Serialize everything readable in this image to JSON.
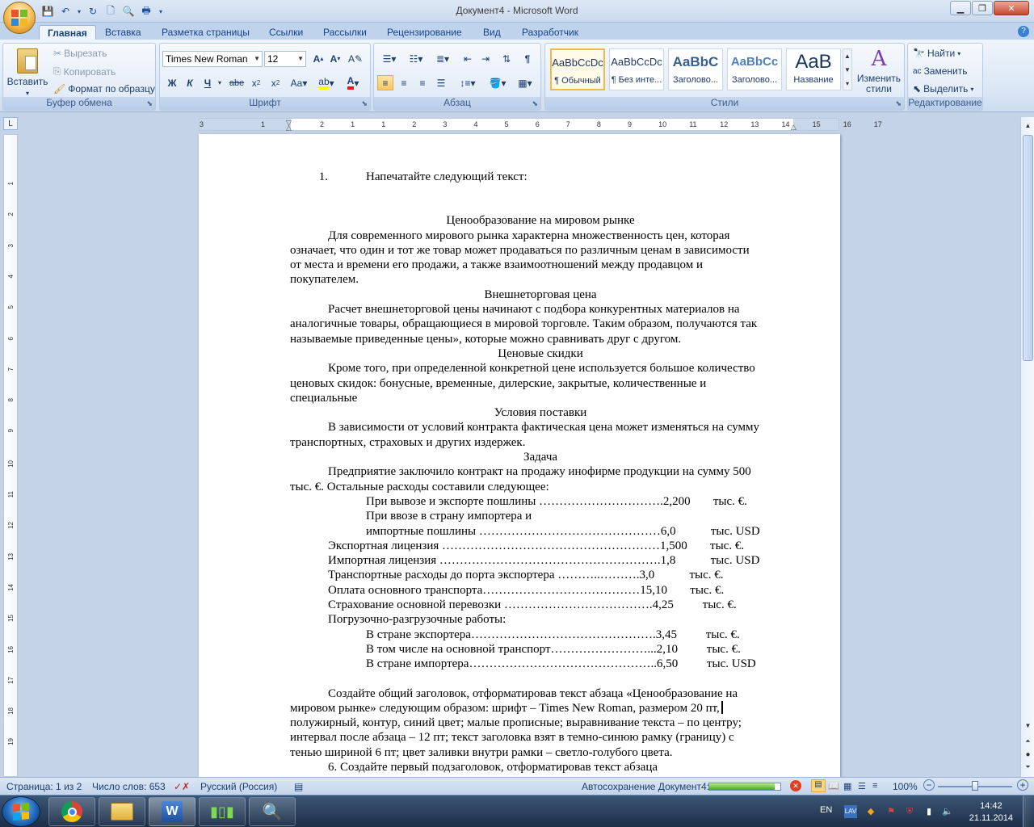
{
  "window": {
    "title": "Документ4 - Microsoft Word"
  },
  "tabs": [
    "Главная",
    "Вставка",
    "Разметка страницы",
    "Ссылки",
    "Рассылки",
    "Рецензирование",
    "Вид",
    "Разработчик"
  ],
  "clipboard": {
    "paste": "Вставить",
    "cut": "Вырезать",
    "copy": "Копировать",
    "format_painter": "Формат по образцу",
    "title": "Буфер обмена"
  },
  "font": {
    "name": "Times New Roman",
    "size": "12",
    "title": "Шрифт"
  },
  "paragraph": {
    "title": "Абзац"
  },
  "styles": {
    "items": [
      {
        "sample": "AaBbCcDc",
        "name": "¶ Обычный"
      },
      {
        "sample": "AaBbCcDc",
        "name": "¶ Без инте..."
      },
      {
        "sample": "AaBbC",
        "name": "Заголово..."
      },
      {
        "sample": "AaBbCc",
        "name": "Заголово..."
      },
      {
        "sample": "AaB",
        "name": "Название"
      }
    ],
    "change": "Изменить стили",
    "title": "Стили"
  },
  "editing": {
    "find": "Найти",
    "replace": "Заменить",
    "select": "Выделить",
    "title": "Редактирование"
  },
  "ruler": {
    "marks": [
      "3",
      "1",
      "2",
      "1",
      "1",
      "2",
      "3",
      "4",
      "5",
      "6",
      "7",
      "8",
      "9",
      "10",
      "11",
      "12",
      "13",
      "14",
      "15",
      "16",
      "17"
    ]
  },
  "vruler": {
    "marks": [
      "1",
      "2",
      "3",
      "4",
      "5",
      "6",
      "7",
      "8",
      "9",
      "10",
      "11",
      "12",
      "13",
      "14",
      "15",
      "16",
      "17",
      "18",
      "19"
    ]
  },
  "doc": {
    "item1": {
      "num": "1.",
      "text": "Напечатайте следующий текст:"
    },
    "h1": "Ценообразование на мировом рынке",
    "p1": [
      "Для современного мирового рынка характерна множественность цен, которая",
      "означает, что один и тот же товар может продаваться по различным ценам в зависимости",
      "от места и времени его продажи, а также взаимоотношений между продавцом и",
      "покупателем."
    ],
    "h2": "Внешнеторговая цена",
    "p2": [
      "Расчет внешнеторговой цены начинают с подбора конкурентных материалов на",
      "аналогичные товары, обращающиеся в мировой торговле. Таким образом, получаются так",
      "называемые приведенные цены», которые можно сравнивать друг с другом."
    ],
    "h3": "Ценовые скидки",
    "p3": [
      "Кроме того, при определенной конкретной цене используется большое количество",
      "ценовых скидок: бонусные, временные, дилерские, закрытые, количественные и",
      "специальные"
    ],
    "h4": "Условия поставки",
    "p4": [
      "В зависимости от условий контракта фактическая цена может изменяться на сумму",
      "транспортных, страховых и других издержек."
    ],
    "h5": "Задача",
    "p5": [
      "Предприятие заключило контракт на продажу инофирме продукции на сумму 500",
      "тыс. €. Остальные расходы составили следующее:"
    ],
    "rows": [
      {
        "indent": 2,
        "label": "При вывозе и экспорте пошлины ………………………….",
        "value": "2,200",
        "unit": "тыс. €."
      },
      {
        "indent": 2,
        "label": "При ввозе в страну импортера и",
        "value": "",
        "unit": ""
      },
      {
        "indent": 2,
        "label": "импортные пошлины ………………………………………",
        "value": "6,0",
        "unit": "тыс. USD"
      },
      {
        "indent": 1,
        "label": "Экспортная лицензия ………………………………………………",
        "value": "1,500",
        "unit": "тыс. €."
      },
      {
        "indent": 1,
        "label": "Импортная лицензия ……………………………………………….",
        "value": "1,8",
        "unit": "тыс. USD"
      },
      {
        "indent": 1,
        "label": "Транспортные расходы до порта экспортера ………..……….",
        "value": "3,0",
        "unit": "тыс.  €."
      },
      {
        "indent": 1,
        "label": "Оплата основного транспорта…………………………………",
        "value": "15,10",
        "unit": "тыс. €."
      },
      {
        "indent": 1,
        "label": "Страхование основной перевозки ……………………………….",
        "value": "4,25",
        "unit": "тыс.  €."
      },
      {
        "indent": 1,
        "label": "Погрузочно-разгрузочные работы:",
        "value": "",
        "unit": ""
      },
      {
        "indent": 2,
        "label": "В стране экспортера……………………………………….",
        "value": "3,45",
        "unit": "тыс. €."
      },
      {
        "indent": 2,
        "label": "В том числе на основной транспорт……………………...",
        "value": "2,10",
        "unit": "тыс. €."
      },
      {
        "indent": 2,
        "label": "В стране импортера………………………………………..",
        "value": "6,50",
        "unit": "тыс. USD"
      }
    ],
    "p6": [
      "Создайте общий заголовок, отформатировав текст абзаца «Ценообразование на",
      "мировом рынке» следующим образом:  шрифт – Times  New Roman, размером 20 пт,",
      "полужирный, контур, синий цвет; малые прописные; выравнивание текста – по центру;",
      "интервал после абзаца – 12 пт; текст заголовка взят в темно-синюю рамку (границу) с",
      "тенью шириной 6 пт; цвет заливки внутри рамки – светло-голубого цвета."
    ],
    "p7": "6.  Создайте  первый  подзаголовок,  отформатировав  текст  абзаца"
  },
  "status": {
    "page": "Страница: 1 из 2",
    "words": "Число слов: 653",
    "lang": "Русский (Россия)",
    "autosave": "Автосохранение Документ4:",
    "autosave_progress": 0.92,
    "zoom": "100%"
  },
  "taskbar": {
    "lang": "EN",
    "time": "14:42",
    "date": "21.11.2014"
  }
}
